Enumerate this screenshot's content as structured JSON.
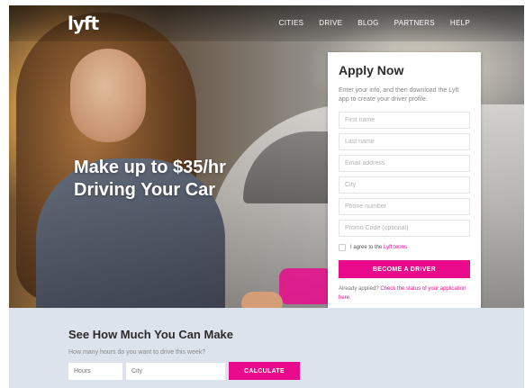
{
  "nav": {
    "logo": "lyft",
    "links": [
      "CITIES",
      "DRIVE",
      "BLOG",
      "PARTNERS",
      "HELP"
    ]
  },
  "hero": {
    "headline_line1": "Make up to $35/hr",
    "headline_line2": "Driving Your Car"
  },
  "form": {
    "title": "Apply Now",
    "description": "Enter your info, and then download the Lyft app to create your driver profile.",
    "placeholders": {
      "first_name": "First name",
      "last_name": "Last name",
      "email": "Email address",
      "city": "City",
      "phone": "Phone number",
      "promo": "Promo Code (optional)"
    },
    "agree_prefix": "I agree to the ",
    "agree_link": "Lyft terms",
    "submit_label": "BECOME A DRIVER",
    "already_prefix": "Already applied? ",
    "already_link": "Check the status of your application here."
  },
  "calculator": {
    "title": "See How Much You Can Make",
    "question": "How many hours do you want to drive this week?",
    "hours_placeholder": "Hours",
    "city_placeholder": "City",
    "button_label": "CALCULATE"
  },
  "colors": {
    "accent": "#ea0b8c",
    "calc_background": "#dde3ec"
  }
}
